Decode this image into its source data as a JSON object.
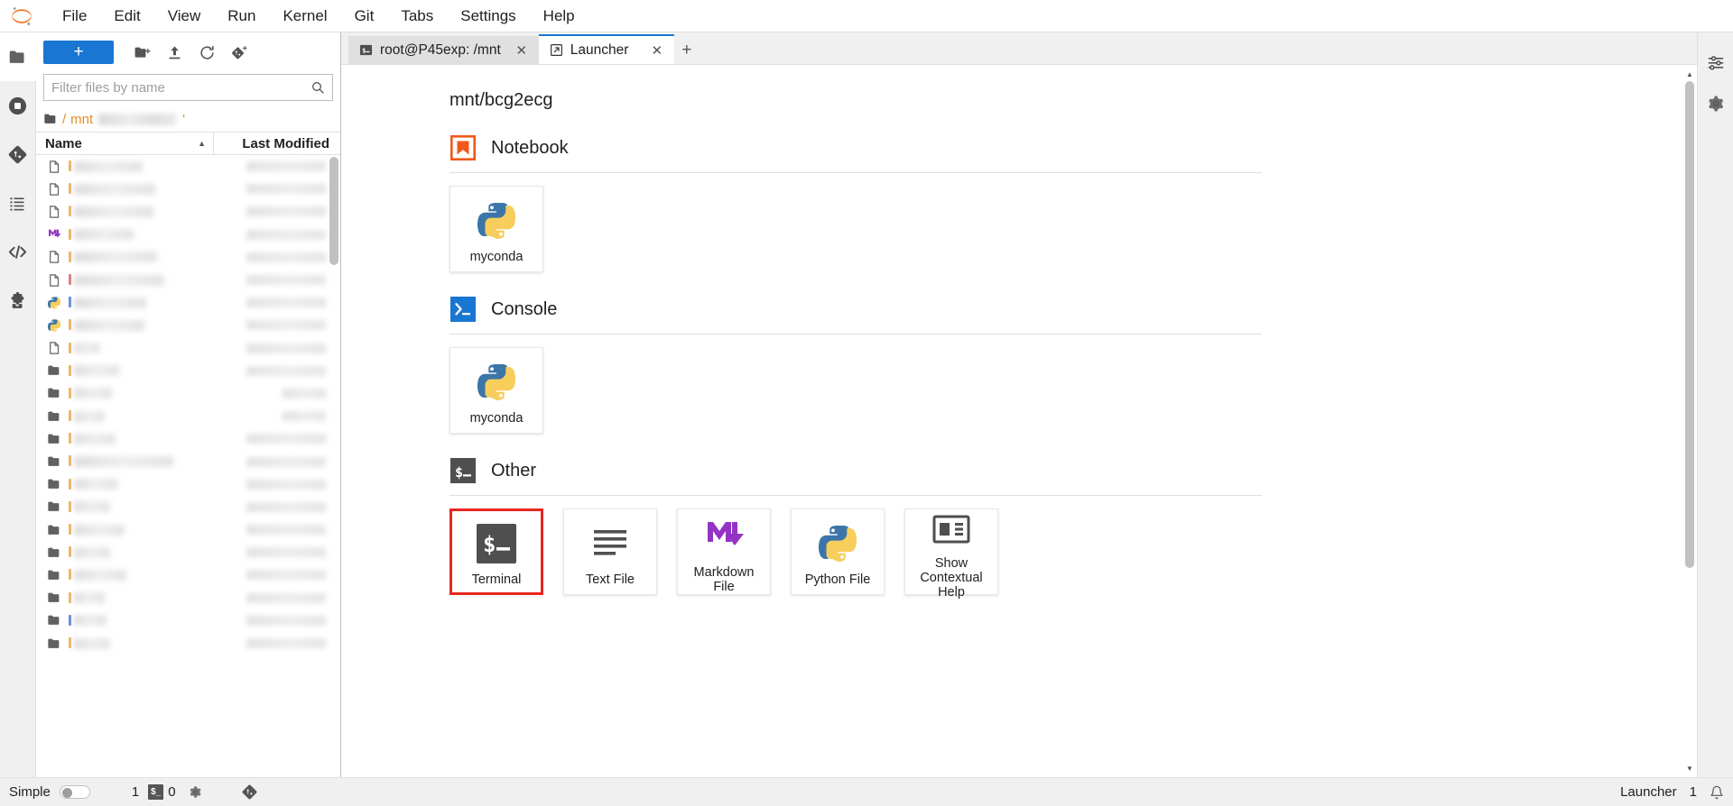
{
  "app": {
    "name": "JupyterLab",
    "logo_icon": "jupyter-logo"
  },
  "menubar": {
    "items": [
      {
        "label": "File"
      },
      {
        "label": "Edit"
      },
      {
        "label": "View"
      },
      {
        "label": "Run"
      },
      {
        "label": "Kernel"
      },
      {
        "label": "Git"
      },
      {
        "label": "Tabs"
      },
      {
        "label": "Settings"
      },
      {
        "label": "Help"
      }
    ]
  },
  "left_sidebar": {
    "items": [
      {
        "icon": "folder-icon",
        "name": "file-browser",
        "active": true
      },
      {
        "icon": "stop-circle-icon",
        "name": "running-terminals-kernels",
        "active": false
      },
      {
        "icon": "git-icon",
        "name": "git-panel",
        "active": false
      },
      {
        "icon": "list-icon",
        "name": "table-of-contents",
        "active": false
      },
      {
        "icon": "code-icon",
        "name": "debugger",
        "active": false
      },
      {
        "icon": "puzzle-icon",
        "name": "extension-manager",
        "active": false
      }
    ]
  },
  "right_sidebar": {
    "items": [
      {
        "icon": "sliders-icon",
        "name": "property-inspector"
      },
      {
        "icon": "gear-icon",
        "name": "settings-panel"
      }
    ]
  },
  "file_browser": {
    "toolbar": {
      "new_launcher_label": "+",
      "new_folder_icon": "new-folder-icon",
      "upload_icon": "upload-icon",
      "refresh_icon": "refresh-icon",
      "new_checkpoint_icon": "git-add-icon"
    },
    "filter": {
      "placeholder": "Filter files by name",
      "value": "",
      "icon": "search-icon"
    },
    "breadcrumb": {
      "home_icon": "folder-icon",
      "sep": "/",
      "root": "mnt",
      "redacted": true
    },
    "columns": {
      "name": "Name",
      "last_modified": "Last Modified",
      "sort_dir": "asc"
    },
    "rows": [
      {
        "type": "folder",
        "tint": "o",
        "name_width": 40,
        "mod_width": "long"
      },
      {
        "type": "folder",
        "tint": "b",
        "name_width": 36,
        "mod_width": "long"
      },
      {
        "type": "folder",
        "tint": "o",
        "name_width": 34,
        "mod_width": "long"
      },
      {
        "type": "folder",
        "tint": "o",
        "name_width": 58,
        "mod_width": "long"
      },
      {
        "type": "folder",
        "tint": "o",
        "name_width": 40,
        "mod_width": "long"
      },
      {
        "type": "folder",
        "tint": "o",
        "name_width": 56,
        "mod_width": "long"
      },
      {
        "type": "folder",
        "tint": "o",
        "name_width": 40,
        "mod_width": "long"
      },
      {
        "type": "folder",
        "tint": "o",
        "name_width": 48,
        "mod_width": "long"
      },
      {
        "type": "folder",
        "tint": "o",
        "name_width": 110,
        "mod_width": "long"
      },
      {
        "type": "folder",
        "tint": "o",
        "name_width": 46,
        "mod_width": "long"
      },
      {
        "type": "folder",
        "tint": "o",
        "name_width": 34,
        "mod_width": "short"
      },
      {
        "type": "folder",
        "tint": "o",
        "name_width": 42,
        "mod_width": "short"
      },
      {
        "type": "folder",
        "tint": "o",
        "name_width": 50,
        "mod_width": "long"
      },
      {
        "type": "file",
        "tint": "o",
        "name_width": 28,
        "mod_width": "long"
      },
      {
        "type": "python",
        "tint": "o",
        "name_width": 78,
        "mod_width": "long"
      },
      {
        "type": "python",
        "tint": "b",
        "name_width": 80,
        "mod_width": "long"
      },
      {
        "type": "file",
        "tint": "r",
        "name_width": 100,
        "mod_width": "long"
      },
      {
        "type": "file",
        "tint": "o",
        "name_width": 92,
        "mod_width": "long"
      },
      {
        "type": "markdown",
        "tint": "o",
        "name_width": 66,
        "mod_width": "long"
      },
      {
        "type": "file",
        "tint": "o",
        "name_width": 88,
        "mod_width": "long"
      },
      {
        "type": "file",
        "tint": "o",
        "name_width": 90,
        "mod_width": "long"
      },
      {
        "type": "file",
        "tint": "o",
        "name_width": 76,
        "mod_width": "long"
      }
    ]
  },
  "tabbar": {
    "tabs": [
      {
        "label": "root@P45exp: /mnt",
        "icon": "terminal-icon",
        "active": false,
        "close_icon": "close-icon"
      },
      {
        "label": "Launcher",
        "icon": "launcher-icon",
        "active": true,
        "close_icon": "close-icon"
      }
    ],
    "add_tab_label": "+"
  },
  "launcher": {
    "path_title": "mnt/bcg2ecg",
    "sections": [
      {
        "title": "Notebook",
        "icon": "notebook-bookmark-icon",
        "cards": [
          {
            "label": "myconda",
            "icon": "python-icon",
            "highlight": false
          }
        ]
      },
      {
        "title": "Console",
        "icon": "console-prompt-icon",
        "cards": [
          {
            "label": "myconda",
            "icon": "python-icon",
            "highlight": false
          }
        ]
      },
      {
        "title": "Other",
        "icon": "terminal-prompt-icon",
        "cards": [
          {
            "label": "Terminal",
            "icon": "terminal-icon",
            "highlight": true
          },
          {
            "label": "Text File",
            "icon": "text-file-icon",
            "highlight": false
          },
          {
            "label": "Markdown File",
            "icon": "markdown-icon",
            "highlight": false
          },
          {
            "label": "Python File",
            "icon": "python-icon",
            "highlight": false
          },
          {
            "label": "Show Contextual Help",
            "icon": "contextual-help-icon",
            "highlight": false
          }
        ]
      }
    ]
  },
  "statusbar": {
    "mode_label": "Simple",
    "mode_enabled": false,
    "kernel_count": "1",
    "terminal_badge": "$_",
    "terminal_count": "0",
    "settings_icon": "gear-icon",
    "git_icon": "git-icon",
    "current_widget": "Launcher",
    "notification_count": "1",
    "bell_icon": "bell-icon"
  },
  "colors": {
    "accent_blue": "#1976d2",
    "brand_orange": "#e8711a",
    "highlight_red": "#e8251f",
    "panel_grey": "#f0f0f0",
    "border_grey": "#e0e0e0",
    "text": "#212121"
  }
}
